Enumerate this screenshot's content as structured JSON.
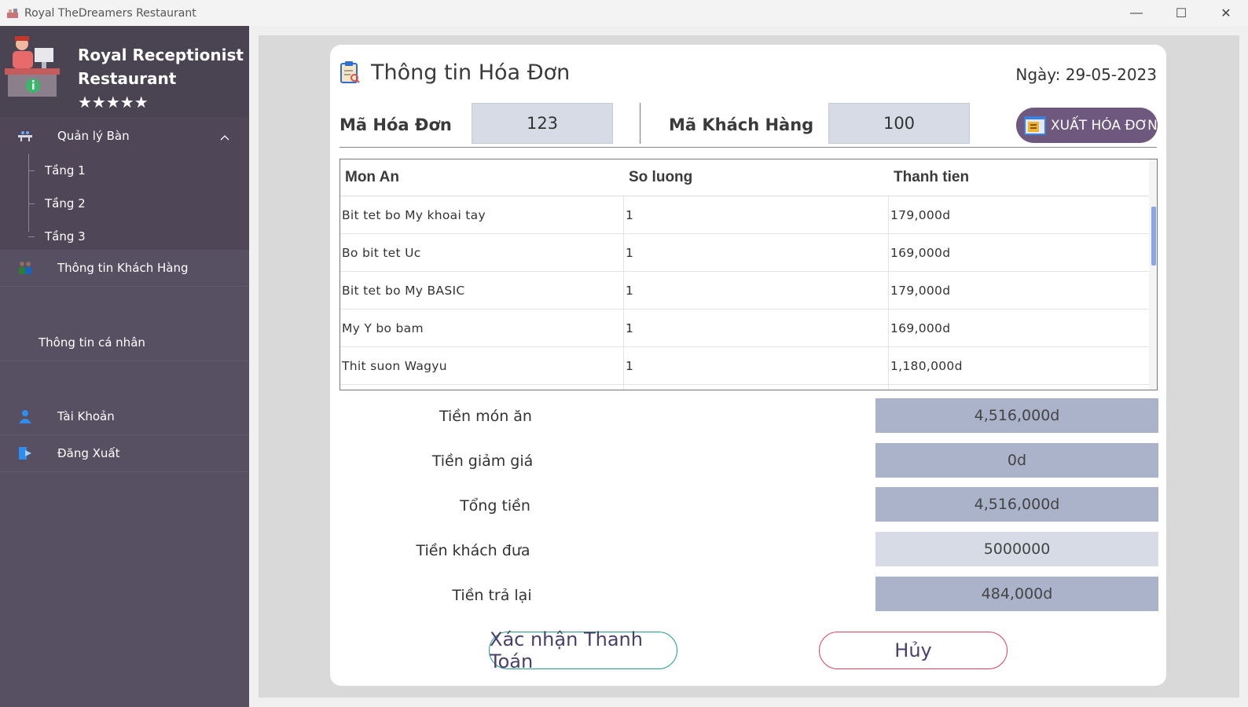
{
  "window": {
    "title": "Royal TheDreamers Restaurant",
    "minimize": "—",
    "maximize": "☐",
    "close": "✕"
  },
  "sidebar": {
    "brand_line1": "Royal Receptionist",
    "brand_line2": "Restaurant ★★★★★",
    "menu_table": "Quản lý Bàn",
    "floors": [
      "Tầng 1",
      "Tầng 2",
      "Tầng 3"
    ],
    "menu_customers": "Thông tin Khách Hàng",
    "menu_profile": "Thông tin cá nhân",
    "menu_account": "Tài Khoản",
    "menu_logout": "Đăng Xuất"
  },
  "invoice": {
    "title": "Thông tin Hóa Đơn",
    "date": "Ngày: 29-05-2023",
    "invoice_id_label": "Mã Hóa Đơn",
    "invoice_id": "123",
    "customer_id_label": "Mã Khách Hàng",
    "customer_id": "100",
    "export_label": "XUẤT HÓA ĐƠN"
  },
  "table": {
    "headers": [
      "Mon An",
      "So luong",
      "Thanh tien"
    ],
    "rows": [
      [
        "Bit tet bo My khoai tay",
        "1",
        "179,000d"
      ],
      [
        "Bo bit tet Uc",
        "1",
        "169,000d"
      ],
      [
        "Bit tet bo My BASIC",
        "1",
        "179,000d"
      ],
      [
        "My Y bo bam",
        "1",
        "169,000d"
      ],
      [
        "Thit suon Wagyu",
        "1",
        "1,180,000d"
      ]
    ]
  },
  "summary": {
    "food_label": "Tiền món ăn",
    "food_value": "4,516,000d",
    "discount_label": "Tiền giảm giá",
    "discount_value": "0d",
    "total_label": "Tổng tiền",
    "total_value": "4,516,000d",
    "paid_label": "Tiền khách đưa",
    "paid_value": "5000000",
    "change_label": "Tiền trả lại",
    "change_value": "484,000d"
  },
  "actions": {
    "confirm": "Xác nhận Thanh Toán",
    "cancel": "Hủy"
  },
  "colors": {
    "sidebar": "#575062",
    "sidebar_header": "#4a4452",
    "accent": "#6e587e",
    "confirm_border": "#1e9a8a",
    "cancel_border": "#e0405a"
  }
}
